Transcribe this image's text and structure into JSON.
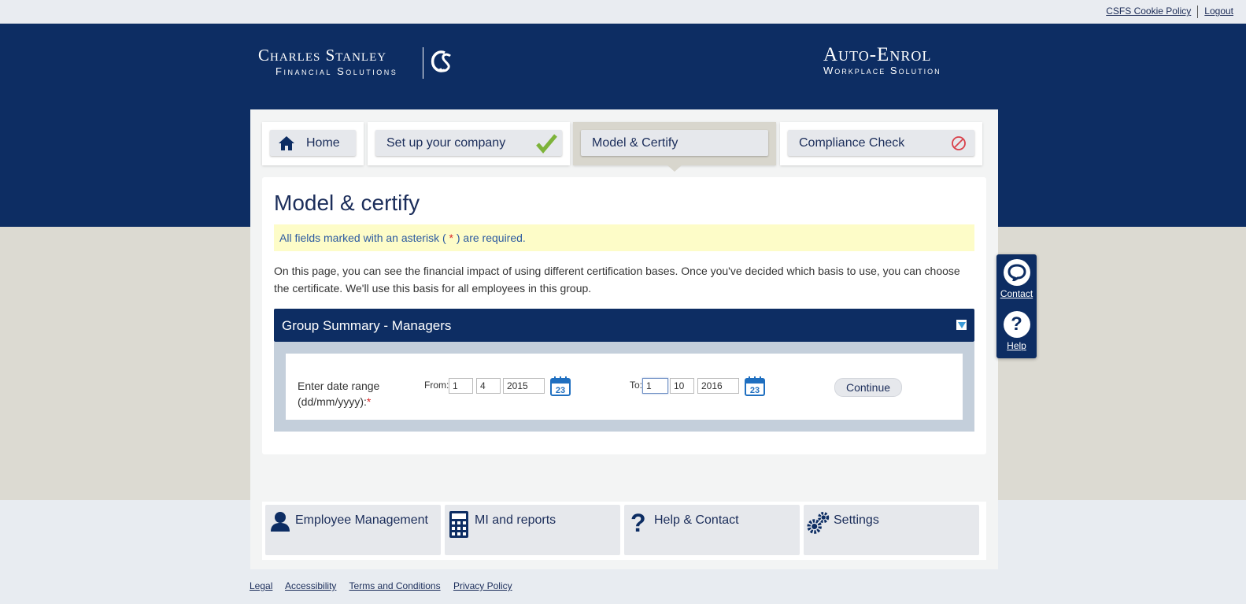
{
  "top_links": {
    "cookie_policy": "CSFS Cookie Policy",
    "logout": "Logout"
  },
  "brand": {
    "left_line1": "Charles Stanley",
    "left_line2": "Financial Solutions",
    "right_line1": "Auto-Enrol",
    "right_line2": "Workplace Solution"
  },
  "tabs": [
    {
      "label": "Home",
      "icon": "home-icon"
    },
    {
      "label": "Set up your company",
      "icon": "checkmark-icon"
    },
    {
      "label": "Model & Certify",
      "icon": "",
      "active": true
    },
    {
      "label": "Compliance Check",
      "icon": "prohibited-icon"
    }
  ],
  "page": {
    "title": "Model & certify",
    "notice_prefix": "All fields marked with an asterisk ( ",
    "notice_star": "*",
    "notice_suffix": " ) are required.",
    "intro": "On this page, you can see the financial impact of using different certification bases. Once you've decided which basis to use, you can choose the certificate. We'll use this basis for all employees in this group."
  },
  "group": {
    "title": "Group Summary - Managers",
    "date_label_line1": "Enter date range",
    "date_label_line2": "(dd/mm/yyyy):",
    "required_star": "*",
    "from_label": "From:",
    "from_day": "1",
    "from_month": "4",
    "from_year": "2015",
    "to_label": "To:",
    "to_day": "1",
    "to_month": "10",
    "to_year": "2016",
    "calendar_day": "23",
    "continue_label": "Continue"
  },
  "side_widget": {
    "contact": "Contact",
    "help": "Help"
  },
  "bottom_nav": [
    {
      "label": "Employee Management",
      "icon": "person-icon"
    },
    {
      "label": "MI and reports",
      "icon": "calculator-icon"
    },
    {
      "label": "Help & Contact",
      "icon": "question-icon"
    },
    {
      "label": "Settings",
      "icon": "gears-icon"
    }
  ],
  "footer": {
    "legal": "Legal",
    "accessibility": "Accessibility",
    "terms": "Terms and Conditions",
    "privacy": "Privacy Policy"
  },
  "colors": {
    "navy": "#0d2d63",
    "beige": "#dcdad2",
    "notice_bg": "#fdfcc8",
    "check_green": "#7db33a",
    "prohibit_red": "#d9404a"
  }
}
